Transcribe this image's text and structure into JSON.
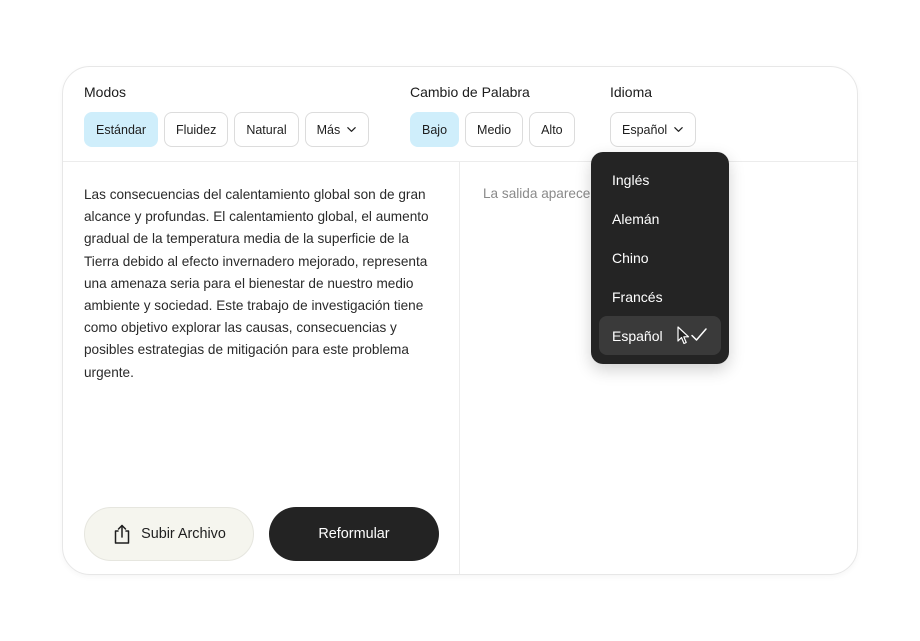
{
  "modes": {
    "label": "Modos",
    "options": [
      "Estándar",
      "Fluidez",
      "Natural"
    ],
    "more_label": "Más",
    "active": "Estándar"
  },
  "word_change": {
    "label": "Cambio de Palabra",
    "options": [
      "Bajo",
      "Medio",
      "Alto"
    ],
    "active": "Bajo"
  },
  "language": {
    "label": "Idioma",
    "selected": "Español",
    "dropdown_open": true,
    "options": [
      "Inglés",
      "Alemán",
      "Chino",
      "Francés",
      "Español"
    ]
  },
  "input": {
    "text": "Las consecuencias del calentamiento global son de gran alcance y profundas. El calentamiento global, el aumento gradual de la temperatura media de la superficie de la Tierra debido al efecto invernadero mejorado, representa una amenaza seria para el bienestar de nuestro medio ambiente y sociedad. Este trabajo de investigación tiene como objetivo explorar las causas, consecuencias y posibles estrategias de mitigación para este problema urgente."
  },
  "output": {
    "placeholder": "La salida aparecerá aquí"
  },
  "actions": {
    "upload_label": "Subir Archivo",
    "primary_label": "Reformular"
  },
  "icons": {
    "upload": "upload-icon",
    "chevron": "chevron-down-icon",
    "check": "check-icon",
    "cursor": "mouse-pointer-icon"
  },
  "colors": {
    "active_chip": "#cfeefb",
    "primary_button": "#232323",
    "dropdown_bg": "#242424",
    "dropdown_selected": "#3a3a3a",
    "upload_button_bg": "#f5f5ee"
  }
}
